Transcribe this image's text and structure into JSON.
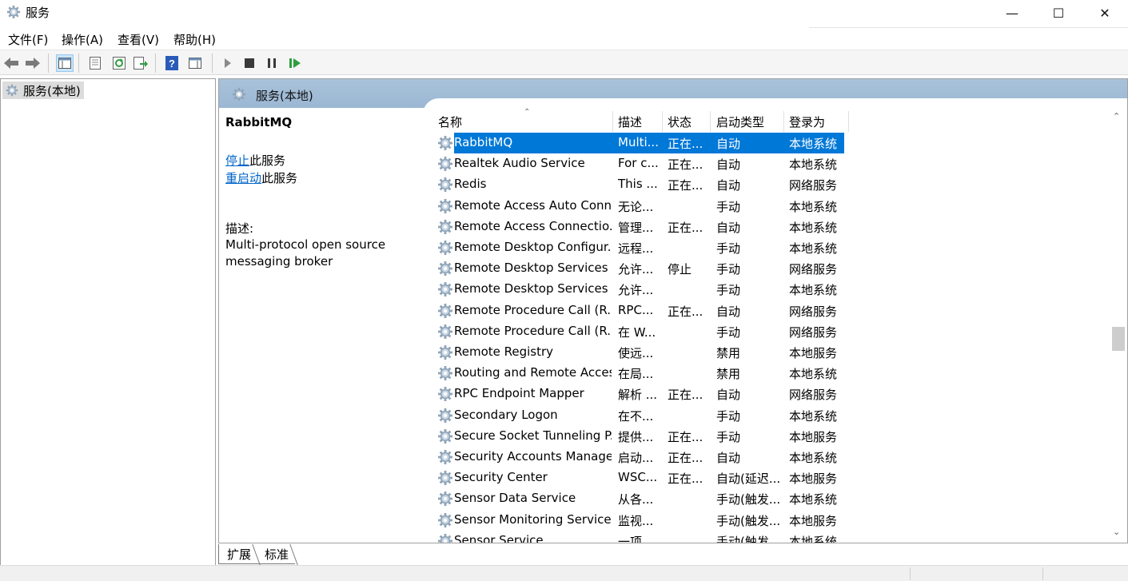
{
  "window": {
    "title": "服务",
    "minimize": "—",
    "maximize": "☐",
    "close": "✕"
  },
  "menu": [
    {
      "label": "文件(F)"
    },
    {
      "label": "操作(A)"
    },
    {
      "label": "查看(V)"
    },
    {
      "label": "帮助(H)"
    }
  ],
  "toolbar": {
    "buttons": [
      "back-icon",
      "forward-icon",
      "show-hide-console-tree-icon",
      "properties-icon",
      "refresh-icon",
      "export-list-icon",
      "help-icon",
      "show-hide-action-pane-icon",
      "start-service-icon",
      "stop-service-icon",
      "pause-service-icon",
      "resume-service-icon"
    ]
  },
  "tree": {
    "root_label": "服务(本地)"
  },
  "panel": {
    "header_title": "服务(本地)",
    "selected_service_name": "RabbitMQ",
    "stop_link": "停止",
    "stop_suffix": "此服务",
    "restart_link": "重启动",
    "restart_suffix": "此服务",
    "description_label": "描述:",
    "description_text": "Multi-protocol open source messaging broker"
  },
  "list": {
    "columns": {
      "name": "名称",
      "description": "描述",
      "status": "状态",
      "startup_type": "启动类型",
      "logon_as": "登录为"
    },
    "sort_indicator": "⌃",
    "rows": [
      {
        "name": "RabbitMQ",
        "description": "Multi...",
        "status": "正在...",
        "startup": "自动",
        "logon": "本地系统",
        "selected": true
      },
      {
        "name": "Realtek Audio Service",
        "description": "For c...",
        "status": "正在...",
        "startup": "自动",
        "logon": "本地系统"
      },
      {
        "name": "Redis",
        "description": "This ...",
        "status": "正在...",
        "startup": "自动",
        "logon": "网络服务"
      },
      {
        "name": "Remote Access Auto Conn...",
        "description": "无论...",
        "status": "",
        "startup": "手动",
        "logon": "本地系统"
      },
      {
        "name": "Remote Access Connectio...",
        "description": "管理...",
        "status": "正在...",
        "startup": "自动",
        "logon": "本地系统"
      },
      {
        "name": "Remote Desktop Configur...",
        "description": "远程...",
        "status": "",
        "startup": "手动",
        "logon": "本地系统"
      },
      {
        "name": "Remote Desktop Services",
        "description": "允许...",
        "status": "停止",
        "startup": "手动",
        "logon": "网络服务"
      },
      {
        "name": "Remote Desktop Services ...",
        "description": "允许...",
        "status": "",
        "startup": "手动",
        "logon": "本地系统"
      },
      {
        "name": "Remote Procedure Call (R...",
        "description": "RPC...",
        "status": "正在...",
        "startup": "自动",
        "logon": "网络服务"
      },
      {
        "name": "Remote Procedure Call (R...",
        "description": "在 W...",
        "status": "",
        "startup": "手动",
        "logon": "网络服务"
      },
      {
        "name": "Remote Registry",
        "description": "使远...",
        "status": "",
        "startup": "禁用",
        "logon": "本地服务"
      },
      {
        "name": "Routing and Remote Access",
        "description": "在局...",
        "status": "",
        "startup": "禁用",
        "logon": "本地系统"
      },
      {
        "name": "RPC Endpoint Mapper",
        "description": "解析 ...",
        "status": "正在...",
        "startup": "自动",
        "logon": "网络服务"
      },
      {
        "name": "Secondary Logon",
        "description": "在不...",
        "status": "",
        "startup": "手动",
        "logon": "本地系统"
      },
      {
        "name": "Secure Socket Tunneling P...",
        "description": "提供...",
        "status": "正在...",
        "startup": "手动",
        "logon": "本地服务"
      },
      {
        "name": "Security Accounts Manager",
        "description": "启动...",
        "status": "正在...",
        "startup": "自动",
        "logon": "本地系统"
      },
      {
        "name": "Security Center",
        "description": "WSC...",
        "status": "正在...",
        "startup": "自动(延迟...",
        "logon": "本地服务"
      },
      {
        "name": "Sensor Data Service",
        "description": "从各...",
        "status": "",
        "startup": "手动(触发...",
        "logon": "本地系统"
      },
      {
        "name": "Sensor Monitoring Service",
        "description": "监视...",
        "status": "",
        "startup": "手动(触发...",
        "logon": "本地服务"
      },
      {
        "name": "Sensor Service",
        "description": "一项...",
        "status": "",
        "startup": "手动(触发...",
        "logon": "本地系统"
      }
    ]
  },
  "scrollbar": {
    "up": "⌃",
    "down": "⌄"
  },
  "tabs": [
    {
      "label": "扩展",
      "active": true
    },
    {
      "label": "标准",
      "active": false
    }
  ],
  "colors": {
    "selection": "#0078d7",
    "header_band": "#9bb7d3",
    "link": "#0064c8"
  }
}
